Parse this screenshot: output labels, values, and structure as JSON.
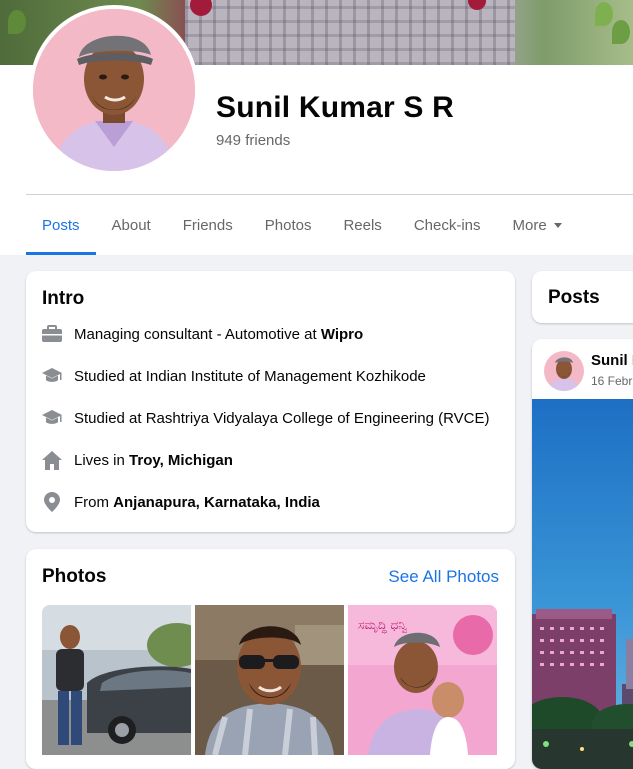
{
  "profile": {
    "name": "Sunil Kumar S R",
    "friends": "949 friends"
  },
  "tabs": [
    {
      "label": "Posts",
      "active": true
    },
    {
      "label": "About"
    },
    {
      "label": "Friends"
    },
    {
      "label": "Photos"
    },
    {
      "label": "Reels"
    },
    {
      "label": "Check-ins"
    },
    {
      "label": "More"
    }
  ],
  "intro": {
    "title": "Intro",
    "items": [
      {
        "icon": "briefcase-icon",
        "text": "Managing consultant - Automotive at ",
        "bold": "Wipro"
      },
      {
        "icon": "graduation-cap-icon",
        "text": "Studied at Indian Institute of Management Kozhikode",
        "bold": ""
      },
      {
        "icon": "graduation-cap-icon",
        "text": "Studied at Rashtriya Vidyalaya College of Engineering (RVCE)",
        "bold": ""
      },
      {
        "icon": "home-icon",
        "text": "Lives in ",
        "bold": "Troy, Michigan"
      },
      {
        "icon": "location-pin-icon",
        "text": "From ",
        "bold": "Anjanapura, Karnataka, India"
      }
    ]
  },
  "photos": {
    "title": "Photos",
    "see_all": "See All Photos",
    "banner_text": "ಸಮೃದ್ಧಿ ಧನ್ವಿ"
  },
  "posts": {
    "title": "Posts",
    "author": "Sunil K",
    "date": "16 Febr"
  },
  "colors": {
    "accent": "#1b74e4",
    "secondary_text": "#65676b",
    "background": "#f0f2f5"
  }
}
